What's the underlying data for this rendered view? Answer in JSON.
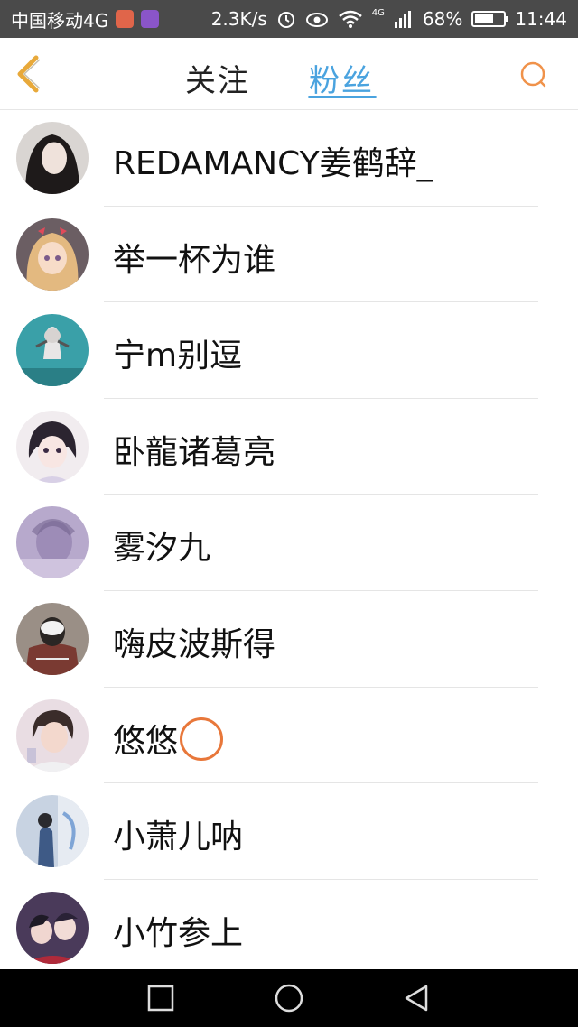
{
  "status_bar": {
    "carrier": "中国移动4G",
    "speed": "2.3K/s",
    "network": "4G",
    "battery": "68%",
    "battery_level": 0.68,
    "time": "11:44"
  },
  "header": {
    "tabs": [
      {
        "label": "关注",
        "active": false
      },
      {
        "label": "粉丝",
        "active": true
      }
    ],
    "accent_color": "#4aa3df",
    "back_icon": "chevron-left-icon",
    "search_icon": "search-icon"
  },
  "fans": [
    {
      "name": "REDAMANCY姜鹤辞_"
    },
    {
      "name": "举一杯为谁"
    },
    {
      "name": "宁m别逗"
    },
    {
      "name": "卧龍诸葛亮"
    },
    {
      "name": "雾汐九"
    },
    {
      "name": "嗨皮波斯得"
    },
    {
      "name": "悠悠"
    },
    {
      "name": "小萧儿呐"
    },
    {
      "name": "小竹参上"
    }
  ],
  "system_nav": {
    "icons": [
      "square-icon",
      "circle-icon",
      "back-triangle-icon"
    ]
  }
}
